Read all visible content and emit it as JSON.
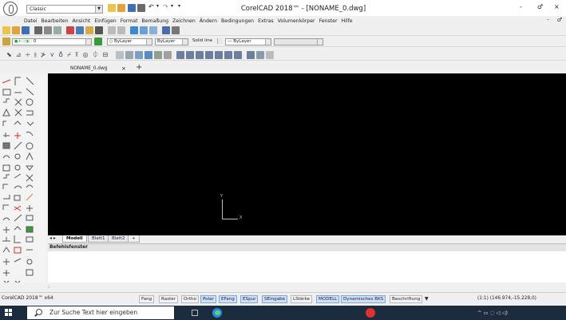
{
  "titlebar": {
    "workspace": "Classic",
    "title": "CorelCAD 2018™ - [NONAME_0.dwg]",
    "minimize": "-",
    "maximize": "♂",
    "close": "×"
  },
  "menu": {
    "items": [
      "Datei",
      "Bearbeiten",
      "Ansicht",
      "Einfügen",
      "Format",
      "Bemaßung",
      "Zeichnen",
      "Ändern",
      "Bedingungen",
      "Extras",
      "Volumenkörper",
      "Fenster",
      "Hilfe"
    ],
    "doc_minimize": "-",
    "doc_restore": "♂"
  },
  "properties_toolbar": {
    "layer": "0",
    "color": "ByLayer",
    "linetype": "ByLayer",
    "linestyle": "Solid line",
    "lineweight": "ByLayer"
  },
  "document_tab": {
    "name": "NONAME_0.dwg",
    "close": "×",
    "add": "+"
  },
  "ucs": {
    "x": "X",
    "y": "Y"
  },
  "layout_tabs": [
    "Modell",
    "Blatt1",
    "Blatt2",
    "+"
  ],
  "command": {
    "title": "Befehlsfenster",
    "prompt": ":"
  },
  "status": {
    "app": "CorelCAD 2018™ x64",
    "buttons": [
      {
        "label": "Fang",
        "on": false
      },
      {
        "label": "Raster",
        "on": false
      },
      {
        "label": "Ortho",
        "on": false
      },
      {
        "label": "Polar",
        "on": true
      },
      {
        "label": "EFang",
        "on": true
      },
      {
        "label": "ESpur",
        "on": true
      },
      {
        "label": "SEingabe",
        "on": true
      },
      {
        "label": "LStärke",
        "on": false
      },
      {
        "label": "MODELL",
        "on": true
      },
      {
        "label": "Dynamisches BKS",
        "on": true
      },
      {
        "label": "Beschriftung",
        "on": false
      }
    ],
    "coords": "(1:1) (146.974,-15.228,0)"
  },
  "taskbar": {
    "search_placeholder": "Zur Suche Text hier eingeben",
    "tray": "^ ▭ ◌ ◁ ◁)"
  }
}
